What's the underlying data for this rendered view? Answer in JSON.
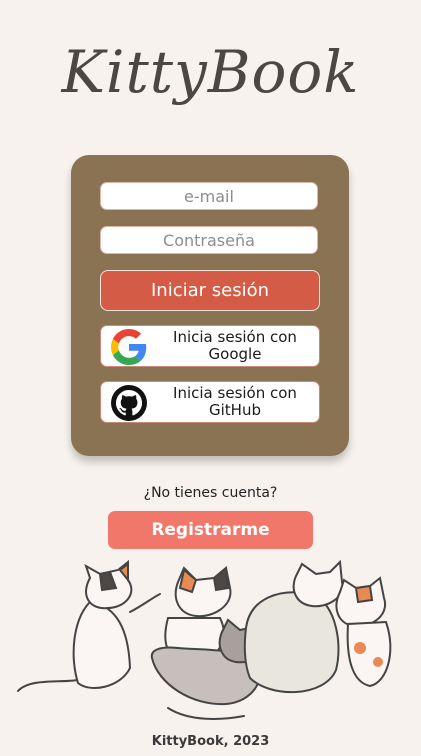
{
  "app": {
    "logo_text": "KittyBook"
  },
  "login": {
    "email_placeholder": "e-mail",
    "password_placeholder": "Contraseña",
    "submit_label": "Iniciar sesión",
    "google_label": "Inicia sesión con Google",
    "github_label": "Inicia sesión con GitHub"
  },
  "signup": {
    "question": "¿No tienes cuenta?",
    "button_label": "Registrarme"
  },
  "footer": {
    "text": "KittyBook, 2023"
  },
  "colors": {
    "background": "#f8f2ee",
    "card": "#8a7352",
    "login_button": "#d45b45",
    "register_button": "#f07769"
  },
  "icons": [
    "google-icon",
    "github-icon"
  ]
}
